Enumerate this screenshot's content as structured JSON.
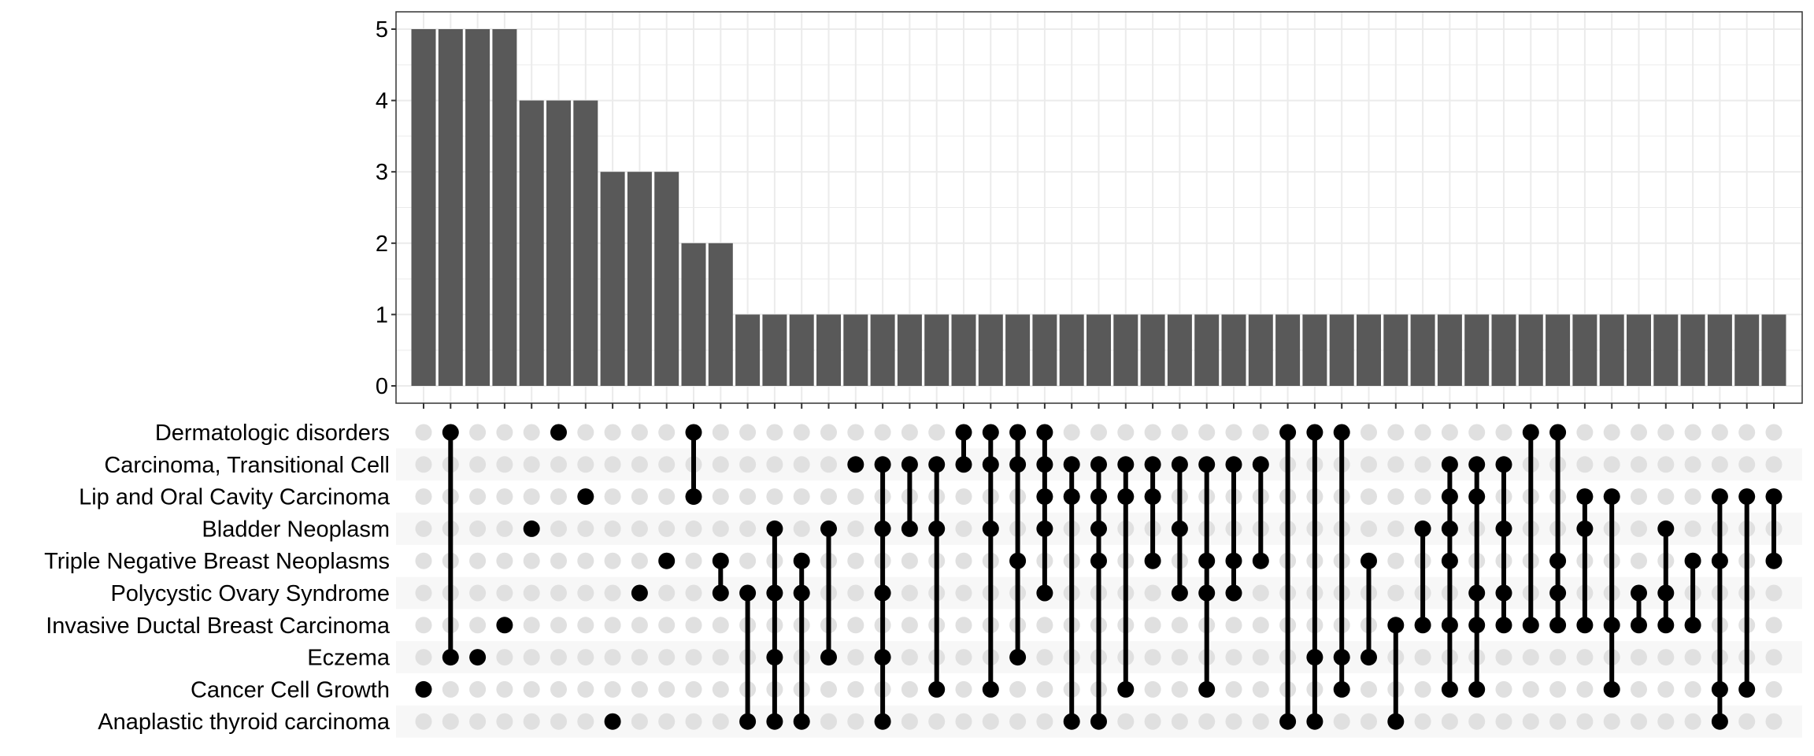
{
  "chart_data": {
    "type": "bar",
    "subtype": "upset",
    "title": "",
    "xlabel": "",
    "ylabel": "",
    "ylim": [
      0,
      5.2
    ],
    "yticks": [
      "0",
      "1",
      "2",
      "3",
      "4",
      "5"
    ],
    "grid": true,
    "sets": [
      "Dermatologic disorders",
      "Carcinoma, Transitional Cell",
      "Lip and Oral Cavity Carcinoma",
      "Bladder Neoplasm",
      "Triple Negative Breast Neoplasms",
      "Polycystic Ovary Syndrome",
      "Invasive Ductal Breast Carcinoma",
      "Eczema",
      "Cancer Cell Growth",
      "Anaplastic thyroid carcinoma"
    ],
    "values": [
      5,
      5,
      5,
      5,
      4,
      4,
      4,
      3,
      3,
      3,
      2,
      2,
      1,
      1,
      1,
      1,
      1,
      1,
      1,
      1,
      1,
      1,
      1,
      1,
      1,
      1,
      1,
      1,
      1,
      1,
      1,
      1,
      1,
      1,
      1,
      1,
      1,
      1,
      1,
      1,
      1,
      1,
      1,
      1,
      1,
      1,
      1,
      1,
      1,
      1,
      1
    ],
    "intersections": [
      [
        8
      ],
      [
        0,
        7
      ],
      [
        7
      ],
      [
        6
      ],
      [
        3
      ],
      [
        0
      ],
      [
        2
      ],
      [
        9
      ],
      [
        5
      ],
      [
        4
      ],
      [
        0,
        2
      ],
      [
        4,
        5
      ],
      [
        5,
        9
      ],
      [
        3,
        5,
        7,
        9
      ],
      [
        4,
        5,
        9
      ],
      [
        3,
        7
      ],
      [
        1
      ],
      [
        1,
        3,
        5,
        7,
        9
      ],
      [
        1,
        3
      ],
      [
        1,
        3,
        8
      ],
      [
        0,
        1
      ],
      [
        0,
        1,
        3,
        8
      ],
      [
        0,
        1,
        4,
        7
      ],
      [
        0,
        1,
        2,
        3,
        5
      ],
      [
        1,
        2,
        9
      ],
      [
        1,
        2,
        3,
        4,
        9
      ],
      [
        1,
        2,
        8
      ],
      [
        1,
        2,
        4
      ],
      [
        1,
        3,
        5
      ],
      [
        1,
        4,
        5,
        8
      ],
      [
        1,
        4,
        5
      ],
      [
        1,
        4
      ],
      [
        0,
        9
      ],
      [
        0,
        7,
        9
      ],
      [
        0,
        7,
        8
      ],
      [
        4,
        7
      ],
      [
        6,
        9
      ],
      [
        3,
        6
      ],
      [
        1,
        2,
        3,
        4,
        6,
        8
      ],
      [
        1,
        2,
        5,
        6,
        8
      ],
      [
        1,
        3,
        5,
        6
      ],
      [
        0,
        6
      ],
      [
        0,
        4,
        5,
        6
      ],
      [
        2,
        3,
        6
      ],
      [
        2,
        6,
        8
      ],
      [
        5,
        6
      ],
      [
        3,
        5,
        6
      ],
      [
        4,
        6
      ],
      [
        2,
        4,
        8,
        9
      ],
      [
        2,
        8
      ],
      [
        2,
        4
      ]
    ],
    "colors": {
      "bar": "#595959",
      "dot_active": "#000000",
      "dot_inactive": "#e0e0e0",
      "stripe": "#f7f7f7",
      "grid": "#ebebeb",
      "panel_border": "#333333"
    }
  }
}
